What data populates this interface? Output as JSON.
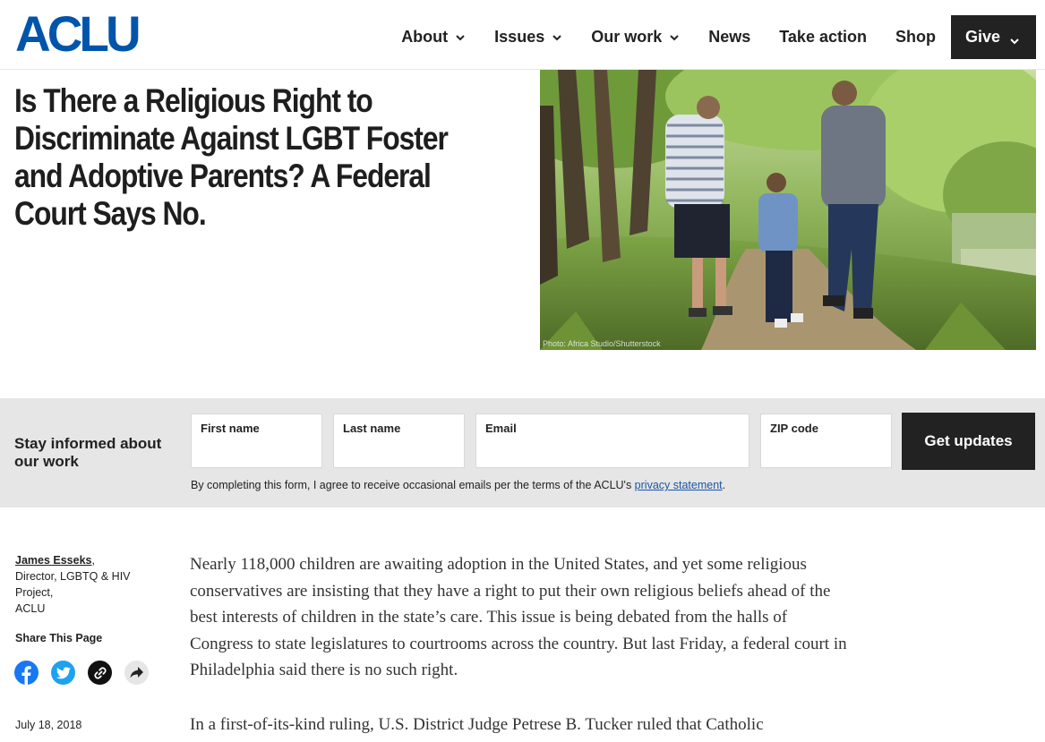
{
  "header": {
    "logo": "ACLU",
    "nav": [
      {
        "label": "About",
        "has_dropdown": true
      },
      {
        "label": "Issues",
        "has_dropdown": true
      },
      {
        "label": "Our work",
        "has_dropdown": true
      },
      {
        "label": "News",
        "has_dropdown": false
      },
      {
        "label": "Take action",
        "has_dropdown": false
      },
      {
        "label": "Shop",
        "has_dropdown": false
      }
    ],
    "give_label": "Give"
  },
  "hero": {
    "headline": "Is There a Religious Right to Discriminate Against LGBT Foster and Adoptive Parents? A Federal Court Says No.",
    "photo_credit": "Photo: Africa Studio/Shutterstock"
  },
  "signup": {
    "title": "Stay informed about our work",
    "fields": {
      "first_name": "First name",
      "last_name": "Last name",
      "email": "Email",
      "zip": "ZIP code"
    },
    "button_label": "Get updates",
    "disclaimer_prefix": "By completing this form, I agree to receive occasional emails per the terms of the ACLU's ",
    "privacy_link": "privacy statement",
    "disclaimer_suffix": "."
  },
  "sidebar": {
    "author_name": "James Esseks",
    "author_suffix": ",",
    "author_role": "Director, LGBTQ & HIV Project,",
    "author_org": "ACLU",
    "share_title": "Share This Page",
    "share_icons": [
      "facebook-icon",
      "twitter-icon",
      "link-icon",
      "share-icon"
    ],
    "date": "July 18, 2018"
  },
  "article": {
    "paragraphs": [
      "Nearly 118,000 children are awaiting adoption in the United States, and yet some religious conservatives are insisting that they have a right to put their own religious beliefs ahead of the best interests of children in the state’s care. This issue is being debated from the halls of Congress to state legislatures to courtrooms across the country. But last Friday, a federal court in Philadelphia said there is no such right.",
      "In a first-of-its-kind ruling, U.S. District Judge Petrese B. Tucker ruled that Catholic"
    ]
  },
  "colors": {
    "brand_blue": "#0055aa",
    "dark": "#222222",
    "band_gray": "#e6e6e6",
    "link_blue": "#1a56a6",
    "facebook": "#1877f2",
    "twitter": "#1da1f2"
  }
}
